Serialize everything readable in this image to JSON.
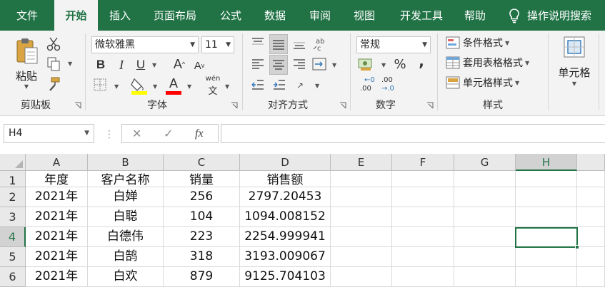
{
  "menu": {
    "tabs": [
      "文件",
      "开始",
      "插入",
      "页面布局",
      "公式",
      "数据",
      "审阅",
      "视图",
      "开发工具",
      "帮助"
    ],
    "active_tab": "开始",
    "help_search": "操作说明搜索"
  },
  "ribbon": {
    "clipboard": {
      "paste_label": "粘贴",
      "group_label": "剪贴板"
    },
    "font": {
      "font_name": "微软雅黑",
      "font_size": "11",
      "bold": "B",
      "italic": "I",
      "underline": "U",
      "grow": "A",
      "shrink": "A",
      "font_color_glyph": "A",
      "phonetic": "wén",
      "group_label": "字体"
    },
    "alignment": {
      "group_label": "对齐方式"
    },
    "number": {
      "format": "常规",
      "percent": "%",
      "comma": ",",
      "inc_decimal": ".00",
      "dec_decimal": ".00",
      "group_label": "数字"
    },
    "styles": {
      "conditional": "条件格式",
      "table_format": "套用表格格式",
      "cell_styles": "单元格样式",
      "group_label": "样式"
    },
    "cells": {
      "label": "单元格"
    }
  },
  "formula_bar": {
    "name_box": "H4",
    "fx": "fx",
    "value": ""
  },
  "sheet": {
    "columns": [
      "A",
      "B",
      "C",
      "D",
      "E",
      "F",
      "G",
      "H"
    ],
    "row_numbers": [
      "1",
      "2",
      "3",
      "4",
      "5",
      "6"
    ],
    "selected_column": "H",
    "selected_row": "4",
    "rows": [
      [
        "年度",
        "客户名称",
        "销量",
        "销售额"
      ],
      [
        "2021年",
        "白婵",
        "256",
        "2797.20453"
      ],
      [
        "2021年",
        "白聪",
        "104",
        "1094.008152"
      ],
      [
        "2021年",
        "白德伟",
        "223",
        "2254.999941"
      ],
      [
        "2021年",
        "白鹄",
        "318",
        "3193.009067"
      ],
      [
        "2021年",
        "白欢",
        "879",
        "9125.704103"
      ]
    ]
  },
  "colors": {
    "accent": "#217346",
    "ribbon_bg": "#f3f3f3",
    "header_bg": "#e9e9e9"
  }
}
